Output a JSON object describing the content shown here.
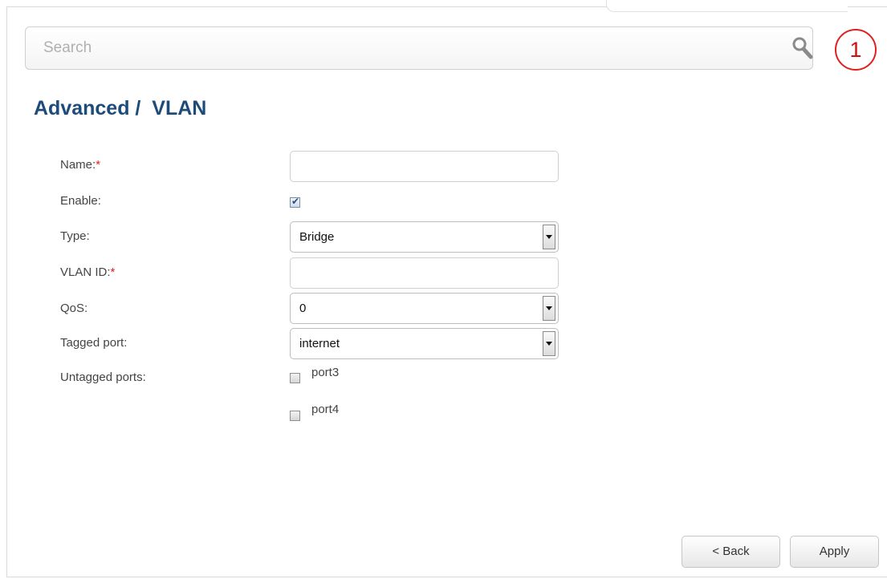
{
  "search": {
    "placeholder": "Search",
    "value": ""
  },
  "notification": {
    "count": "1"
  },
  "page": {
    "title": "Advanced /  VLAN"
  },
  "form": {
    "name": {
      "label": "Name:",
      "required_mark": "*",
      "value": ""
    },
    "enable": {
      "label": "Enable:",
      "checked": true
    },
    "type": {
      "label": "Type:",
      "selected": "Bridge"
    },
    "vlan_id": {
      "label": "VLAN ID:",
      "required_mark": "*",
      "value": ""
    },
    "qos": {
      "label": "QoS:",
      "selected": "0"
    },
    "tagged_port": {
      "label": "Tagged port:",
      "selected": "internet"
    },
    "untagged_ports": {
      "label": "Untagged ports:",
      "ports": [
        {
          "label": "port3",
          "checked": false
        },
        {
          "label": "port4",
          "checked": false
        }
      ]
    }
  },
  "buttons": {
    "back": "< Back",
    "apply": "Apply"
  },
  "colors": {
    "title": "#1d4b7a",
    "required": "#e02020",
    "badge": "#e02020"
  }
}
